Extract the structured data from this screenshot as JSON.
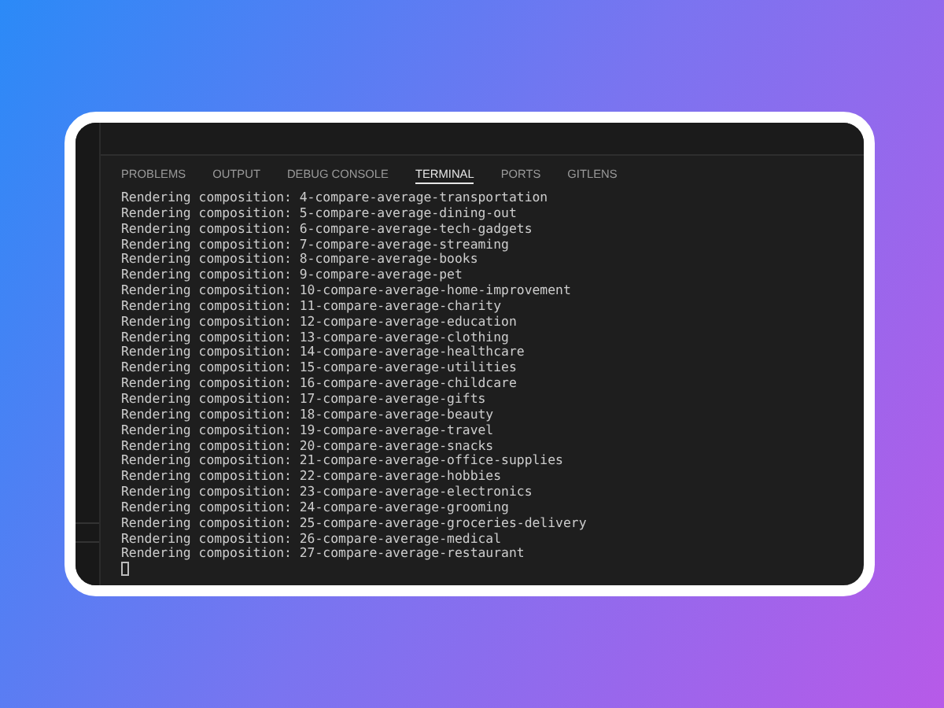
{
  "panel": {
    "tabs": [
      {
        "label": "PROBLEMS",
        "selected": false
      },
      {
        "label": "OUTPUT",
        "selected": false
      },
      {
        "label": "DEBUG CONSOLE",
        "selected": false
      },
      {
        "label": "TERMINAL",
        "selected": true
      },
      {
        "label": "PORTS",
        "selected": false
      },
      {
        "label": "GITLENS",
        "selected": false
      }
    ],
    "terminal": {
      "lines": [
        "Rendering composition: 4-compare-average-transportation",
        "Rendering composition: 5-compare-average-dining-out",
        "Rendering composition: 6-compare-average-tech-gadgets",
        "Rendering composition: 7-compare-average-streaming",
        "Rendering composition: 8-compare-average-books",
        "Rendering composition: 9-compare-average-pet",
        "Rendering composition: 10-compare-average-home-improvement",
        "Rendering composition: 11-compare-average-charity",
        "Rendering composition: 12-compare-average-education",
        "Rendering composition: 13-compare-average-clothing",
        "Rendering composition: 14-compare-average-healthcare",
        "Rendering composition: 15-compare-average-utilities",
        "Rendering composition: 16-compare-average-childcare",
        "Rendering composition: 17-compare-average-gifts",
        "Rendering composition: 18-compare-average-beauty",
        "Rendering composition: 19-compare-average-travel",
        "Rendering composition: 20-compare-average-snacks",
        "Rendering composition: 21-compare-average-office-supplies",
        "Rendering composition: 22-compare-average-hobbies",
        "Rendering composition: 23-compare-average-electronics",
        "Rendering composition: 24-compare-average-grooming",
        "Rendering composition: 25-compare-average-groceries-delivery",
        "Rendering composition: 26-compare-average-medical",
        "Rendering composition: 27-compare-average-restaurant"
      ]
    }
  }
}
